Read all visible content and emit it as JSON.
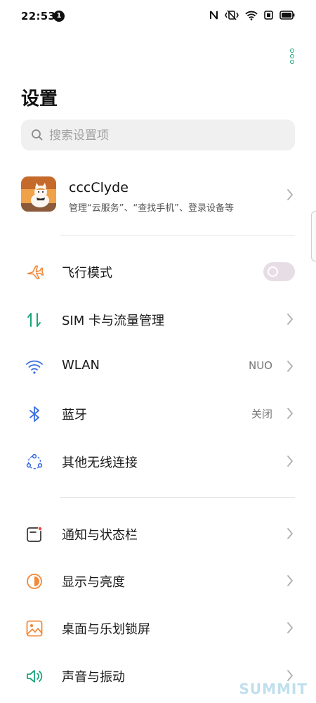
{
  "status_bar": {
    "time": "22:53",
    "notification_count": "1",
    "icons": [
      "nfc-icon",
      "vibrate-icon",
      "wifi-icon",
      "screen-record-icon",
      "battery-icon"
    ]
  },
  "header": {
    "title": "设置",
    "more_icon": "more-vertical-icon"
  },
  "search": {
    "placeholder": "搜索设置项"
  },
  "account": {
    "name": "cccClyde",
    "subtitle": "管理“云服务”、“查找手机”、登录设备等"
  },
  "section1": [
    {
      "label": "飞行模式",
      "icon": "airplane-icon",
      "control": "toggle",
      "toggle_on": false
    },
    {
      "label": "SIM 卡与流量管理",
      "icon": "sim-data-icon"
    },
    {
      "label": "WLAN",
      "icon": "wifi-icon",
      "value": "NUO"
    },
    {
      "label": "蓝牙",
      "icon": "bluetooth-icon",
      "value": "关闭"
    },
    {
      "label": "其他无线连接",
      "icon": "wireless-connections-icon"
    }
  ],
  "section2": [
    {
      "label": "通知与状态栏",
      "icon": "notification-icon"
    },
    {
      "label": "显示与亮度",
      "icon": "brightness-icon"
    },
    {
      "label": "桌面与乐划锁屏",
      "icon": "wallpaper-icon"
    },
    {
      "label": "声音与振动",
      "icon": "sound-icon"
    }
  ],
  "colors": {
    "accent": "#1aa57a",
    "airplane": "#f08a3c",
    "sim": "#1aa57a",
    "wlan": "#3a6fe0",
    "bluetooth": "#3a6fe0",
    "notification": "#333333",
    "brightness": "#f08a3c",
    "wallpaper": "#f08a3c",
    "sound": "#1aa57a"
  },
  "watermark": "SUMMIT"
}
